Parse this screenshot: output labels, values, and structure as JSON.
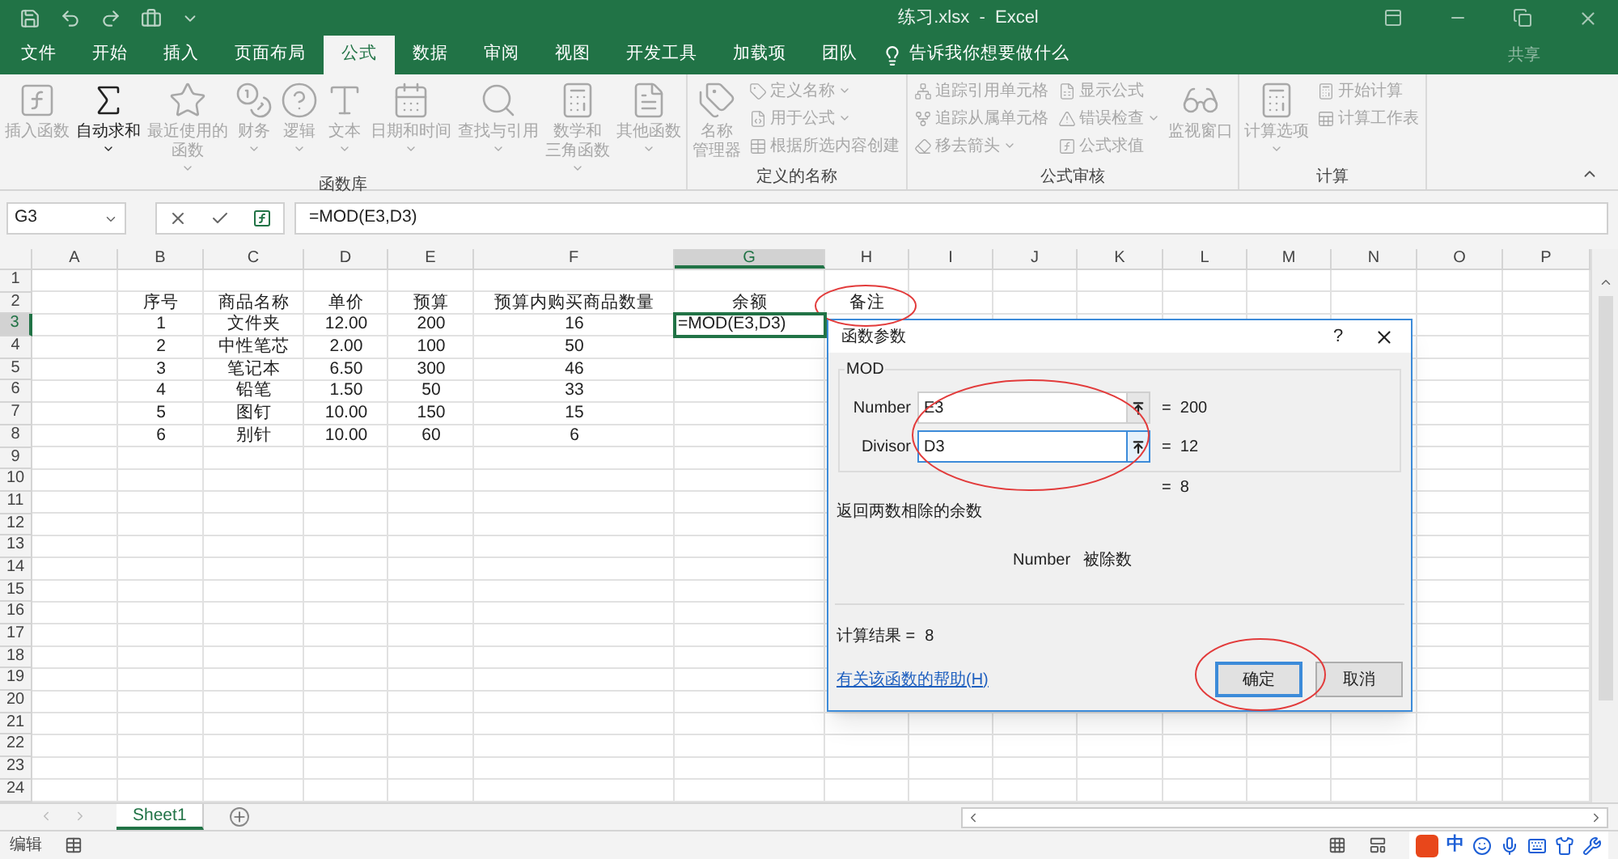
{
  "title_bar": {
    "title": "练习.xlsx  -  Excel"
  },
  "ribbon_tabs": [
    {
      "label": "文件",
      "selected": false
    },
    {
      "label": "开始",
      "selected": false
    },
    {
      "label": "插入",
      "selected": false
    },
    {
      "label": "页面布局",
      "selected": false
    },
    {
      "label": "公式",
      "selected": true
    },
    {
      "label": "数据",
      "selected": false
    },
    {
      "label": "审阅",
      "selected": false
    },
    {
      "label": "视图",
      "selected": false
    },
    {
      "label": "开发工具",
      "selected": false
    },
    {
      "label": "加载项",
      "selected": false
    },
    {
      "label": "团队",
      "selected": false
    }
  ],
  "tell_me": "告诉我你想要做什么",
  "share": "共享",
  "ribbon_groups": [
    {
      "label": "函数库",
      "items": [
        {
          "kind": "large",
          "label": "插入函数",
          "disabled": true
        },
        {
          "kind": "large",
          "label": "自动求和",
          "disabled": false,
          "dropdown": true
        },
        {
          "kind": "large",
          "label": [
            "最近使用的",
            "函数"
          ],
          "disabled": true,
          "dropdown": true
        },
        {
          "kind": "large",
          "label": "财务",
          "disabled": true,
          "dropdown": true
        },
        {
          "kind": "large",
          "label": "逻辑",
          "disabled": true,
          "dropdown": true
        },
        {
          "kind": "large",
          "label": "文本",
          "disabled": true,
          "dropdown": true
        },
        {
          "kind": "large",
          "label": "日期和时间",
          "disabled": true,
          "dropdown": true
        },
        {
          "kind": "large",
          "label": "查找与引用",
          "disabled": true,
          "dropdown": true
        },
        {
          "kind": "large",
          "label": [
            "数学和",
            "三角函数"
          ],
          "disabled": true,
          "dropdown": true
        },
        {
          "kind": "large",
          "label": "其他函数",
          "disabled": true,
          "dropdown": true
        }
      ]
    },
    {
      "label": "定义的名称",
      "items": [
        {
          "kind": "large",
          "label": [
            "名称",
            "管理器"
          ],
          "disabled": true
        },
        {
          "kind": "small",
          "label": "定义名称",
          "disabled": true,
          "dropdown": true
        },
        {
          "kind": "small",
          "label": "用于公式",
          "disabled": true,
          "dropdown": true
        },
        {
          "kind": "small",
          "label": "根据所选内容创建",
          "disabled": true
        }
      ]
    },
    {
      "label": "公式审核",
      "items": [
        {
          "kind": "small",
          "label": "追踪引用单元格",
          "disabled": true
        },
        {
          "kind": "small",
          "label": "追踪从属单元格",
          "disabled": true
        },
        {
          "kind": "small",
          "label": "移去箭头",
          "disabled": true,
          "dropdown": true
        },
        {
          "kind": "small",
          "label": "显示公式",
          "disabled": true
        },
        {
          "kind": "small",
          "label": "错误检查",
          "disabled": true,
          "dropdown": true
        },
        {
          "kind": "small",
          "label": "公式求值",
          "disabled": true
        },
        {
          "kind": "large",
          "label": "监视窗口",
          "disabled": true
        }
      ]
    },
    {
      "label": "计算",
      "items": [
        {
          "kind": "large",
          "label": "计算选项",
          "disabled": true,
          "dropdown": true
        },
        {
          "kind": "small",
          "label": "开始计算",
          "disabled": true
        },
        {
          "kind": "small",
          "label": "计算工作表",
          "disabled": true
        }
      ]
    }
  ],
  "formula_bar": {
    "name_box": "G3",
    "formula": "=MOD(E3,D3)"
  },
  "columns": [
    {
      "label": "A",
      "selected": false
    },
    {
      "label": "B",
      "selected": false
    },
    {
      "label": "C",
      "selected": false
    },
    {
      "label": "D",
      "selected": false
    },
    {
      "label": "E",
      "selected": false
    },
    {
      "label": "F",
      "selected": false
    },
    {
      "label": "G",
      "selected": true
    },
    {
      "label": "H",
      "selected": false
    },
    {
      "label": "I",
      "selected": false
    },
    {
      "label": "J",
      "selected": false
    },
    {
      "label": "K",
      "selected": false
    },
    {
      "label": "L",
      "selected": false
    },
    {
      "label": "M",
      "selected": false
    },
    {
      "label": "N",
      "selected": false
    },
    {
      "label": "O",
      "selected": false
    },
    {
      "label": "P",
      "selected": false
    }
  ],
  "rows": [
    {
      "number": "1",
      "selected": false
    },
    {
      "number": "2",
      "selected": false,
      "cells": [
        "序号",
        "商品名称",
        "单价",
        "预算",
        "预算内购买商品数量",
        "余额",
        "备注"
      ]
    },
    {
      "number": "3",
      "selected": true,
      "cells": [
        "1",
        "文件夹",
        "12.00",
        "200",
        "16",
        "=MOD(E3,D3)"
      ]
    },
    {
      "number": "4",
      "selected": false,
      "cells": [
        "2",
        "中性笔芯",
        "2.00",
        "100",
        "50"
      ]
    },
    {
      "number": "5",
      "selected": false,
      "cells": [
        "3",
        "笔记本",
        "6.50",
        "300",
        "46"
      ]
    },
    {
      "number": "6",
      "selected": false,
      "cells": [
        "4",
        "铅笔",
        "1.50",
        "50",
        "33"
      ]
    },
    {
      "number": "7",
      "selected": false,
      "cells": [
        "5",
        "图钉",
        "10.00",
        "150",
        "15"
      ]
    },
    {
      "number": "8",
      "selected": false,
      "cells": [
        "6",
        "别针",
        "10.00",
        "60",
        "6"
      ]
    },
    {
      "number": "9",
      "selected": false
    },
    {
      "number": "10",
      "selected": false
    },
    {
      "number": "11",
      "selected": false
    },
    {
      "number": "12",
      "selected": false
    },
    {
      "number": "13",
      "selected": false
    },
    {
      "number": "14",
      "selected": false
    },
    {
      "number": "15",
      "selected": false
    },
    {
      "number": "16",
      "selected": false
    },
    {
      "number": "17",
      "selected": false
    },
    {
      "number": "18",
      "selected": false
    },
    {
      "number": "19",
      "selected": false
    },
    {
      "number": "20",
      "selected": false
    },
    {
      "number": "21",
      "selected": false
    },
    {
      "number": "22",
      "selected": false
    },
    {
      "number": "23",
      "selected": false
    },
    {
      "number": "24",
      "selected": false
    }
  ],
  "sheet_tabs": [
    {
      "label": "Sheet1",
      "selected": true
    }
  ],
  "status_bar": {
    "mode": "编辑",
    "ime": "中"
  },
  "dialog": {
    "title": "函数参数",
    "help": "?",
    "function_name": "MOD",
    "args": [
      {
        "label": "Number",
        "value": "E3",
        "result": "=  200",
        "focused": false
      },
      {
        "label": "Divisor",
        "value": "D3",
        "result": "=  12",
        "focused": true
      }
    ],
    "result_line": "=  8",
    "description": "返回两数相除的余数",
    "arg_name": "Number",
    "arg_help": "被除数",
    "calc_label": "计算结果 =",
    "calc_result": "8",
    "help_link": "有关该函数的帮助(H)",
    "buttons": [
      {
        "label": "确定",
        "selected": true
      },
      {
        "label": "取消",
        "selected": false
      }
    ]
  }
}
